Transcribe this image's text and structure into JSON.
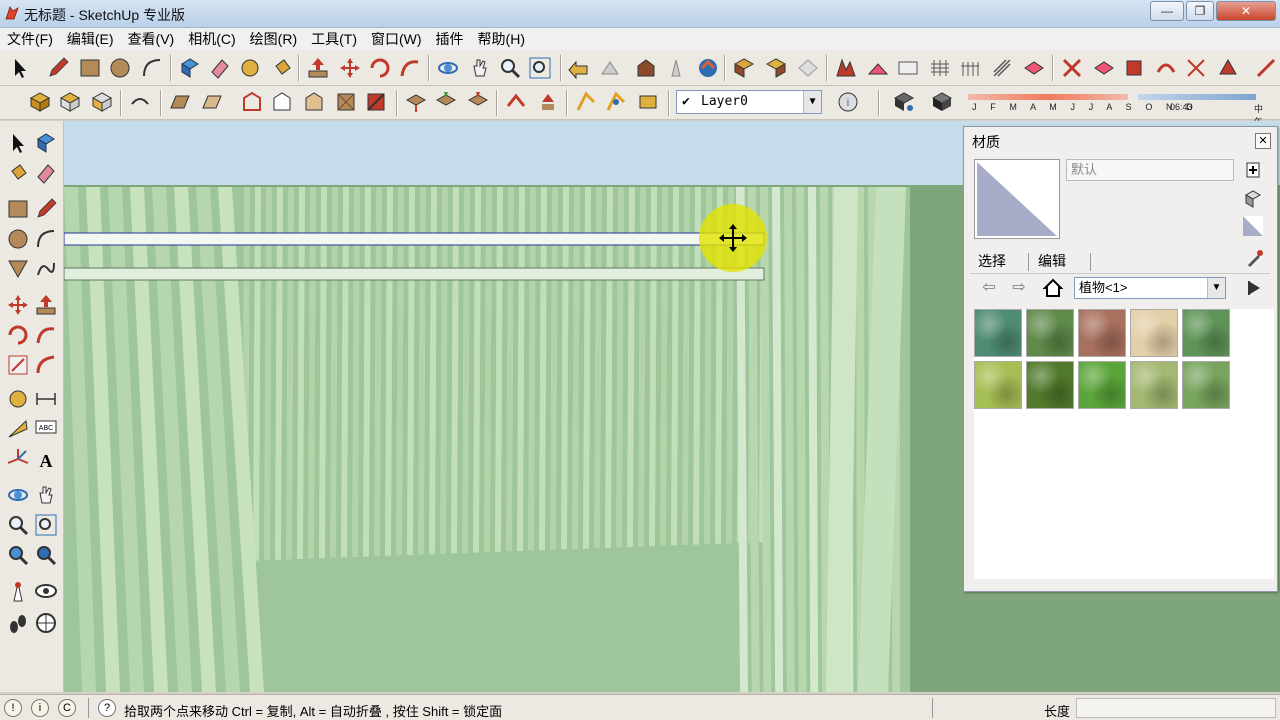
{
  "window": {
    "title": "无标题 - SketchUp 专业版",
    "controls": [
      "—",
      "❐",
      "✕"
    ]
  },
  "menu": [
    "文件(F)",
    "编辑(E)",
    "查看(V)",
    "相机(C)",
    "绘图(R)",
    "工具(T)",
    "窗口(W)",
    "插件",
    "帮助(H)"
  ],
  "layers": {
    "current": "Layer0"
  },
  "shadow": {
    "months": "J F M A M J J A S O N D",
    "time": "06:43",
    "noon": "中午"
  },
  "materials_panel": {
    "title": "材质",
    "name_placeholder": "默认",
    "tabs": [
      "选择",
      "编辑"
    ],
    "collection": "植物<1>",
    "swatch_colors": [
      "#4f8c74",
      "#5f8a4a",
      "#a9705e",
      "#e3cfa8",
      "#5f9458",
      "#a6bf54",
      "#527a2c",
      "#5ba63a",
      "#a4b872",
      "#79a45e"
    ]
  },
  "status": {
    "text": "拾取两个点来移动 Ctrl = 复制, Alt = 自动折叠 , 按住 Shift = 锁定面",
    "measure_label": "长度",
    "measure_value": ""
  },
  "colors": {
    "sky": "#c5dcea",
    "ground": "#7fa57b",
    "fence": "#bfdcb4",
    "highlight": "#e2e200"
  }
}
